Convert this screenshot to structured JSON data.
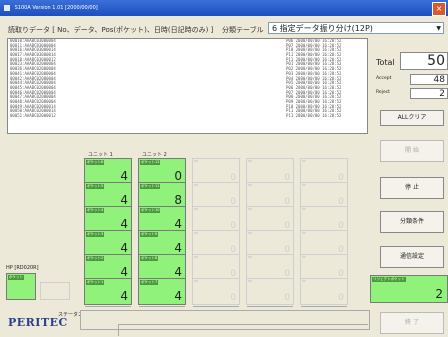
{
  "window": {
    "title": "S100A Version 1.01  [2000/00/00]"
  },
  "fields": {
    "receive_label": "読取りデータ [ No、データ、Pos(ポケット)、日時(日記時のみ) ]",
    "table_label": "分類テーブル",
    "table_number": "6",
    "table_value": "指定データ振り分け(12P)"
  },
  "data_list": {
    "rows": [
      {
        "left": "00010:AAABC03000004",
        "right": "P06 2000/00/00 16:20:52"
      },
      {
        "left": "00011:AAABC03000004",
        "right": "P07 2000/00/00 16:20:52"
      },
      {
        "left": "00016:AAABC03000014",
        "right": "P10 2000/00/00 16:20:52"
      },
      {
        "left": "00017:AAABC03000014",
        "right": "P11 2000/00/00 16:20:52"
      },
      {
        "left": "00018:AAABC03000012",
        "right": "P11 2000/00/00 16:20:52"
      },
      {
        "left": "00023:AAABC02000004",
        "right": "P01 2000/00/00 16:20:52"
      },
      {
        "left": "00036:AAABC02000004",
        "right": "P02 2000/00/00 16:20:52"
      },
      {
        "left": "00041:AAABC02000004",
        "right": "P03 2000/00/00 16:20:52"
      },
      {
        "left": "00042:AAABC02000004",
        "right": "P04 2000/00/00 16:20:52"
      },
      {
        "left": "00044:AAABC02000004",
        "right": "P05 2000/00/00 16:20:52"
      },
      {
        "left": "00045:AAABC02000004",
        "right": "P06 2000/00/00 16:20:52"
      },
      {
        "left": "00046:AAABC02000004",
        "right": "P07 2000/00/00 16:20:52"
      },
      {
        "left": "00047:AAABC02000004",
        "right": "P08 2000/00/00 16:20:52"
      },
      {
        "left": "00048:AAABC02000004",
        "right": "P09 2000/00/00 16:20:52"
      },
      {
        "left": "00049:AAABC02000014",
        "right": "P10 2000/00/00 16:20:52"
      },
      {
        "left": "00050:AAABC02000014",
        "right": "P11 2000/00/00 16:20:52"
      },
      {
        "left": "00051:AAABC02000012",
        "right": "P11 2000/00/00 16:20:52"
      }
    ]
  },
  "stats": {
    "total_label": "Total",
    "total_value": "50",
    "accept_label": "Accept",
    "accept_value": "48",
    "reject_label": "Reject",
    "reject_value": "2"
  },
  "buttons": {
    "clear": "ALLクリア",
    "start": "開 始",
    "stop": "停 止",
    "sort_condition": "分類条件",
    "comm_settings": "通信設定",
    "end": "終 了"
  },
  "units": {
    "unit1": "ユニット 1",
    "unit2": "ユニット 2"
  },
  "pockets": {
    "unit1": [
      {
        "tag": "ポケット6",
        "value": "4"
      },
      {
        "tag": "ポケット5",
        "value": "4"
      },
      {
        "tag": "ポケット4",
        "value": "4"
      },
      {
        "tag": "ポケット3",
        "value": "4"
      },
      {
        "tag": "ポケット2",
        "value": "4"
      },
      {
        "tag": "ポケット1",
        "value": "4"
      }
    ],
    "unit2": [
      {
        "tag": "ポケット12",
        "value": "0"
      },
      {
        "tag": "ポケット11",
        "value": "8"
      },
      {
        "tag": "ポケット10",
        "value": "4"
      },
      {
        "tag": "ポケット9",
        "value": "4"
      },
      {
        "tag": "ポケット8",
        "value": "4"
      },
      {
        "tag": "ポケット7",
        "value": "4"
      }
    ],
    "grey_value": "0"
  },
  "hp": {
    "label": "HP [RD020R]",
    "tag": "ポケット"
  },
  "reject_pocket": {
    "tag": "リジェクトポケット",
    "value": "2"
  },
  "status": {
    "label": "ステータス"
  },
  "logo": {
    "text": "PERITEC"
  }
}
